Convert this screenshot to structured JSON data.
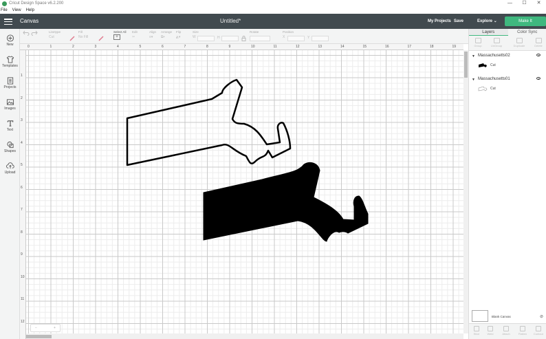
{
  "window": {
    "title": "Cricut Design Space v6.2.200",
    "controls": [
      "—",
      "☐",
      "✕"
    ]
  },
  "menu": {
    "items": [
      "File",
      "View",
      "Help"
    ]
  },
  "header": {
    "section": "Canvas",
    "doc_title": "Untitled*",
    "my_projects": "My Projects",
    "save": "Save",
    "machine": "Explore",
    "make_it": "Make It",
    "accent": "#3fb87f",
    "bar_color": "#414a4f"
  },
  "toolbar": {
    "linetype_label": "Linetype",
    "linetype_value": "Cut",
    "fill_label": "Fill",
    "fill_value": "No Fill",
    "select_all_label": "Select All",
    "edit_label": "Edit",
    "align_label": "Align",
    "arrange_label": "Arrange",
    "flip_label": "Flip",
    "size_label": "Size",
    "size_w": "W",
    "size_h": "H",
    "rotate_label": "Rotate",
    "position_label": "Position",
    "pos_x": "X",
    "pos_y": "Y"
  },
  "leftnav": {
    "items": [
      {
        "label": "New",
        "icon": "plus-circle-icon"
      },
      {
        "label": "Templates",
        "icon": "shirt-icon"
      },
      {
        "label": "Projects",
        "icon": "projects-icon"
      },
      {
        "label": "Images",
        "icon": "image-icon"
      },
      {
        "label": "Text",
        "icon": "text-icon"
      },
      {
        "label": "Shapes",
        "icon": "shapes-icon"
      },
      {
        "label": "Upload",
        "icon": "upload-icon"
      }
    ]
  },
  "rulers": {
    "top": [
      "0",
      "1",
      "2",
      "3",
      "4",
      "5",
      "6",
      "7",
      "8",
      "9",
      "10",
      "11",
      "12",
      "13",
      "14",
      "15",
      "16",
      "17",
      "18",
      "19"
    ],
    "left": [
      "1",
      "2",
      "3",
      "4",
      "5",
      "6",
      "7",
      "8",
      "9",
      "10",
      "11",
      "12"
    ]
  },
  "zoom": {
    "minus": "−",
    "plus": "+",
    "level": ""
  },
  "rightpanel": {
    "tabs": [
      "Layers",
      "Color Sync"
    ],
    "actions": [
      "Group",
      "UnGroup",
      "Duplicate",
      "Delete"
    ],
    "layers": [
      {
        "name": "Massachusetts02",
        "op": "Cut",
        "fill": "#000000"
      },
      {
        "name": "Massachusetts01",
        "op": "Cut",
        "fill": "none"
      }
    ],
    "blank_canvas": "Blank Canvas",
    "bottom_actions": [
      "Slice",
      "Weld",
      "Attach",
      "Flatten",
      "Contour"
    ]
  }
}
